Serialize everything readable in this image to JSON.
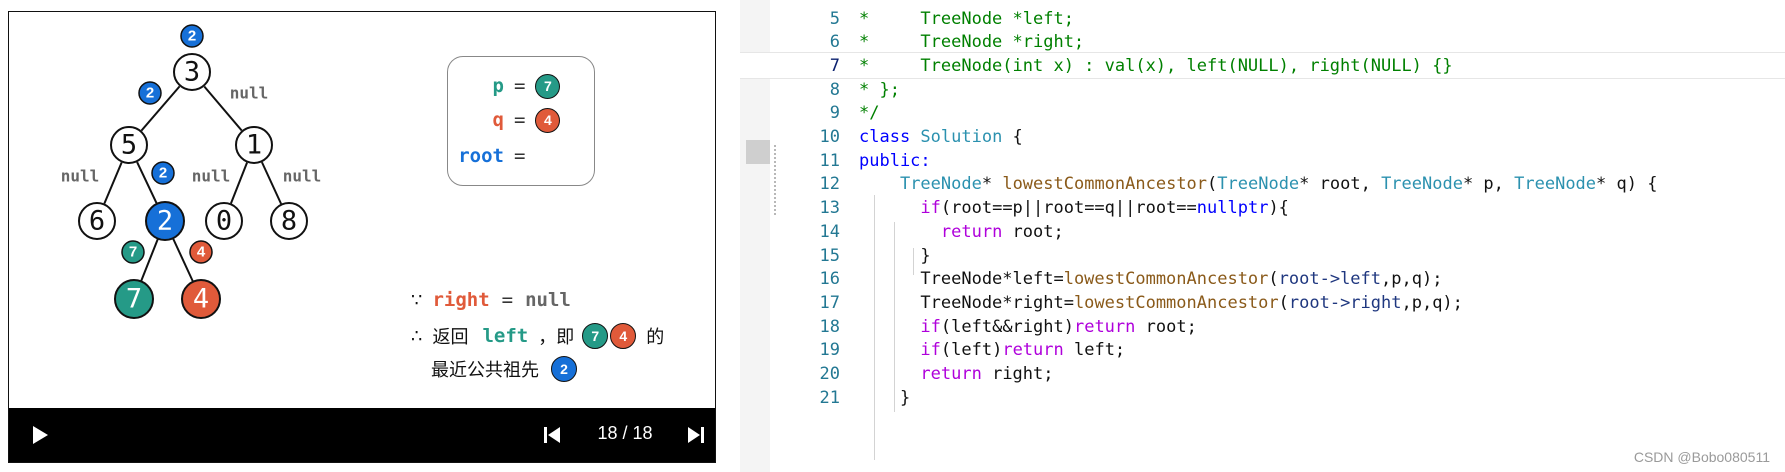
{
  "colors": {
    "blue": "#1670d8",
    "teal": "#259a87",
    "orange": "#e05a3a",
    "keyword": "#0000ff",
    "type": "#2b91af",
    "comment": "#008000",
    "function": "#8a5a1a",
    "control": "#af00db",
    "member": "#1f377f",
    "plain": "#111111"
  },
  "slide": {
    "tree": {
      "nodes": [
        {
          "id": "n3",
          "label": "3",
          "fill": "white"
        },
        {
          "id": "n5",
          "label": "5",
          "fill": "white"
        },
        {
          "id": "n1",
          "label": "1",
          "fill": "white"
        },
        {
          "id": "n6",
          "label": "6",
          "fill": "white"
        },
        {
          "id": "n2",
          "label": "2",
          "fill": "blue"
        },
        {
          "id": "n0",
          "label": "0",
          "fill": "white"
        },
        {
          "id": "n8",
          "label": "8",
          "fill": "white"
        },
        {
          "id": "n7",
          "label": "7",
          "fill": "teal"
        },
        {
          "id": "n4",
          "label": "4",
          "fill": "orange"
        }
      ],
      "edges": [
        [
          "n3",
          "n5"
        ],
        [
          "n3",
          "n1"
        ],
        [
          "n5",
          "n6"
        ],
        [
          "n5",
          "n2"
        ],
        [
          "n1",
          "n0"
        ],
        [
          "n1",
          "n8"
        ],
        [
          "n2",
          "n7"
        ],
        [
          "n2",
          "n4"
        ]
      ],
      "badges": [
        {
          "id": "b-root",
          "label": "2",
          "color": "blue"
        },
        {
          "id": "b-left3",
          "label": "2",
          "color": "blue"
        },
        {
          "id": "b-right5",
          "label": "2",
          "color": "blue"
        },
        {
          "id": "b-left2",
          "label": "7",
          "color": "teal"
        },
        {
          "id": "b-right2",
          "label": "4",
          "color": "orange"
        }
      ],
      "null_labels": [
        {
          "id": "null-right3",
          "text": "null"
        },
        {
          "id": "null-left5",
          "text": "null"
        },
        {
          "id": "null-left1",
          "text": "null"
        },
        {
          "id": "null-right1",
          "text": "null"
        }
      ]
    },
    "vars": {
      "p_label": "p",
      "q_label": "q",
      "root_label": "root",
      "eq": "=",
      "p_value": "7",
      "q_value": "4"
    },
    "explain": {
      "because_symbol": "∵",
      "right_word": "right",
      "eq": "=",
      "null_word": "null",
      "therefore_symbol": "∴",
      "return_text": "返回",
      "left_word": "left",
      "comma_ji": "，即",
      "badge_a": "7",
      "badge_b": "4",
      "de": "的",
      "lca_text": "最近公共祖先",
      "badge_c": "2"
    },
    "player": {
      "page_counter": "18 / 18",
      "play_icon": "play-icon",
      "prev_icon": "skip-previous-icon",
      "next_icon": "skip-next-icon"
    }
  },
  "editor": {
    "current_line": 7,
    "lines": [
      {
        "no": "5",
        "tokens": [
          [
            "comment",
            "*     TreeNode *left;"
          ]
        ]
      },
      {
        "no": "6",
        "tokens": [
          [
            "comment",
            "*     TreeNode *right;"
          ]
        ]
      },
      {
        "no": "7",
        "tokens": [
          [
            "comment",
            "*     TreeNode(int x) : val(x), left(NULL), right(NULL) {}"
          ]
        ]
      },
      {
        "no": "8",
        "tokens": [
          [
            "comment",
            "* };"
          ]
        ]
      },
      {
        "no": "9",
        "tokens": [
          [
            "comment",
            "*/"
          ]
        ]
      },
      {
        "no": "10",
        "tokens": [
          [
            "keyword",
            "class "
          ],
          [
            "type",
            "Solution"
          ],
          [
            "plain",
            " {"
          ]
        ]
      },
      {
        "no": "11",
        "tokens": [
          [
            "keyword",
            "public:"
          ]
        ]
      },
      {
        "no": "12",
        "tokens": [
          [
            "plain",
            "    "
          ],
          [
            "type",
            "TreeNode"
          ],
          [
            "plain",
            "* "
          ],
          [
            "function",
            "lowestCommonAncestor"
          ],
          [
            "plain",
            "("
          ],
          [
            "type",
            "TreeNode"
          ],
          [
            "plain",
            "* root, "
          ],
          [
            "type",
            "TreeNode"
          ],
          [
            "plain",
            "* p, "
          ],
          [
            "type",
            "TreeNode"
          ],
          [
            "plain",
            "* q) {"
          ]
        ]
      },
      {
        "no": "13",
        "tokens": [
          [
            "plain",
            "      "
          ],
          [
            "control",
            "if"
          ],
          [
            "plain",
            "(root==p||root==q||root=="
          ],
          [
            "keyword",
            "nullptr"
          ],
          [
            "plain",
            "){"
          ]
        ]
      },
      {
        "no": "14",
        "tokens": [
          [
            "plain",
            "        "
          ],
          [
            "control",
            "return"
          ],
          [
            "plain",
            " root;"
          ]
        ]
      },
      {
        "no": "15",
        "tokens": [
          [
            "plain",
            "      }"
          ]
        ]
      },
      {
        "no": "16",
        "tokens": [
          [
            "plain",
            "      TreeNode*left="
          ],
          [
            "function",
            "lowestCommonAncestor"
          ],
          [
            "plain",
            "("
          ],
          [
            "member",
            "root->left"
          ],
          [
            "plain",
            ",p,q);"
          ]
        ]
      },
      {
        "no": "17",
        "tokens": [
          [
            "plain",
            "      TreeNode*right="
          ],
          [
            "function",
            "lowestCommonAncestor"
          ],
          [
            "plain",
            "("
          ],
          [
            "member",
            "root->right"
          ],
          [
            "plain",
            ",p,q);"
          ]
        ]
      },
      {
        "no": "18",
        "tokens": [
          [
            "plain",
            "      "
          ],
          [
            "control",
            "if"
          ],
          [
            "plain",
            "(left&&right)"
          ],
          [
            "control",
            "return"
          ],
          [
            "plain",
            " root;"
          ]
        ]
      },
      {
        "no": "19",
        "tokens": [
          [
            "plain",
            "      "
          ],
          [
            "control",
            "if"
          ],
          [
            "plain",
            "(left)"
          ],
          [
            "control",
            "return"
          ],
          [
            "plain",
            " left;"
          ]
        ]
      },
      {
        "no": "20",
        "tokens": [
          [
            "plain",
            "      "
          ],
          [
            "control",
            "return"
          ],
          [
            "plain",
            " right;"
          ]
        ]
      },
      {
        "no": "21",
        "tokens": [
          [
            "plain",
            "    }"
          ]
        ]
      }
    ]
  },
  "watermark": "CSDN @Bobo080511"
}
